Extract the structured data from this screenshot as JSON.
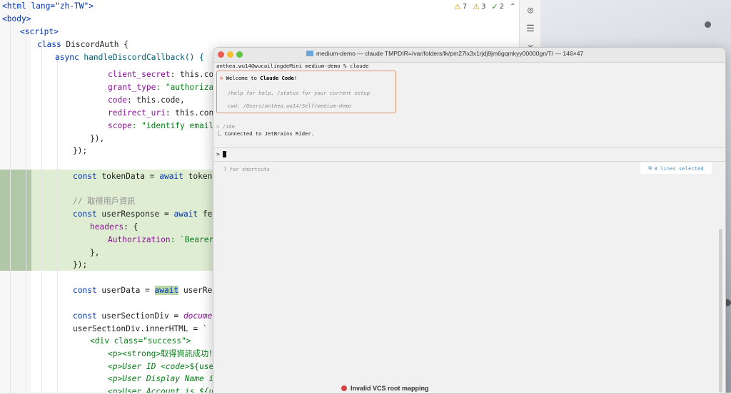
{
  "editor": {
    "inspections": {
      "warnings": "7",
      "weak_warnings": "3",
      "typos": "2"
    },
    "lines": {
      "l1": "<html lang=\"zh-TW\">",
      "l2": "<body>",
      "l3": "<script>",
      "l4_kw": "class",
      "l4_name": " DiscordAuth {",
      "l5_kw": "async",
      "l5_name": " handleDiscordCallback() {",
      "l6_prop": "client_secret",
      "l6_rest": ": this.conf",
      "l7_prop": "grant_type",
      "l7_rest": ": \"authorizati",
      "l8_prop": "code",
      "l8_rest": ": this.code,",
      "l9_prop": "redirect_uri",
      "l9_rest": ": this.confi",
      "l10_prop": "scope",
      "l10_rest": ": \"identify email\",",
      "l11": "}),",
      "l12": "});",
      "l13_kw": "const",
      "l13_var": " tokenData = ",
      "l13_await": "await",
      "l13_rest": " tokenRes",
      "l14": "// 取得用戶資訊",
      "l15_kw": "const",
      "l15_var": " userResponse = ",
      "l15_await": "await",
      "l15_rest": " fetch",
      "l16_prop": "headers",
      "l16_rest": ": {",
      "l17_prop": "Authorization",
      "l17_rest": ": `Bearer $",
      "l18": "},",
      "l19": "});",
      "l20_kw": "const",
      "l20_var": " userData = ",
      "l20_await": "await",
      "l20_rest": " userRespo",
      "l21_kw": "const",
      "l21_var": " userSectionDiv = ",
      "l21_rest": "document.",
      "l22": "userSectionDiv.innerHTML = `",
      "l23": "<div class=\"success\">",
      "l24_a": "<p><strong>",
      "l24_b": "取得資訊成功！<",
      "l25_a": "<p>User ID <code>",
      "l25_b": "${userD",
      "l26": "<p>User Display Name is ",
      "l27": "<p>User Account is ${userData.username}</p>"
    }
  },
  "terminal": {
    "title": "medium-demo — claude TMPDIR=/var/folders/lk/pm27lx3x1rjdj9jm6gqmkyy00000gn/T/ — 146×47",
    "prompt": "anthea.wu14@wucailingdeMini medium-demo % claude",
    "welcome_prefix": "Welcome to ",
    "welcome_name": "Claude Code",
    "welcome_suffix": "!",
    "help_text": "/help for help, /status for your current setup",
    "cwd_text": "cwd: /Users/anthea.wu14/Self/medium-demo",
    "ide_command": "> /ide",
    "ide_result": "⎿  Connected to JetBrains Rider.",
    "input_prompt": ">",
    "shortcuts_hint": "? for shortcuts",
    "selection_status": "8 lines selected"
  },
  "notification": {
    "vcs_text": "Invalid VCS root mapping"
  },
  "colors": {
    "accent_orange": "#d9744a",
    "selection_green": "#dfeed3",
    "link_blue": "#4a90c2"
  }
}
